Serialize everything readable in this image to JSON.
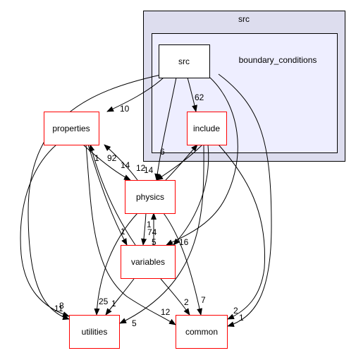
{
  "clusters": {
    "outer": {
      "label": "src",
      "fill": "#ddddee"
    },
    "inner": {
      "label": "boundary_conditions",
      "fill": "#eeeeff"
    }
  },
  "nodes": {
    "src": "src",
    "include": "include",
    "properties": "properties",
    "physics": "physics",
    "variables": "variables",
    "utilities": "utilities",
    "common": "common"
  },
  "edges": [
    {
      "from": "src",
      "to": "properties",
      "label": "10"
    },
    {
      "from": "src",
      "to": "include",
      "label": "62"
    },
    {
      "from": "src",
      "to": "utilities",
      "label": "11"
    },
    {
      "from": "properties",
      "to": "utilities",
      "label": "8"
    },
    {
      "from": "src",
      "to": "physics",
      "label": "12"
    },
    {
      "from": "src",
      "to": "variables",
      "label": "5"
    },
    {
      "from": "src",
      "to": "common",
      "label": "1"
    },
    {
      "from": "include",
      "to": "physics",
      "label": "14"
    },
    {
      "from": "physics",
      "to": "include",
      "label": "6"
    },
    {
      "from": "include",
      "to": "variables",
      "label": "16"
    },
    {
      "from": "include",
      "to": "utilities",
      "label": "5"
    },
    {
      "from": "include",
      "to": "common",
      "label": "2"
    },
    {
      "from": "properties",
      "to": "physics",
      "label": "14"
    },
    {
      "from": "physics",
      "to": "properties",
      "label": "92"
    },
    {
      "from": "properties",
      "to": "variables",
      "label": "1"
    },
    {
      "from": "variables",
      "to": "properties",
      "label": "1"
    },
    {
      "from": "properties",
      "to": "common",
      "label": "12"
    },
    {
      "from": "physics",
      "to": "variables",
      "label": "74"
    },
    {
      "from": "variables",
      "to": "physics",
      "label": "1"
    },
    {
      "from": "physics",
      "to": "utilities",
      "label": "25"
    },
    {
      "from": "physics",
      "to": "common",
      "label": "7"
    },
    {
      "from": "variables",
      "to": "utilities",
      "label": "1"
    },
    {
      "from": "variables",
      "to": "common",
      "label": "2"
    }
  ]
}
